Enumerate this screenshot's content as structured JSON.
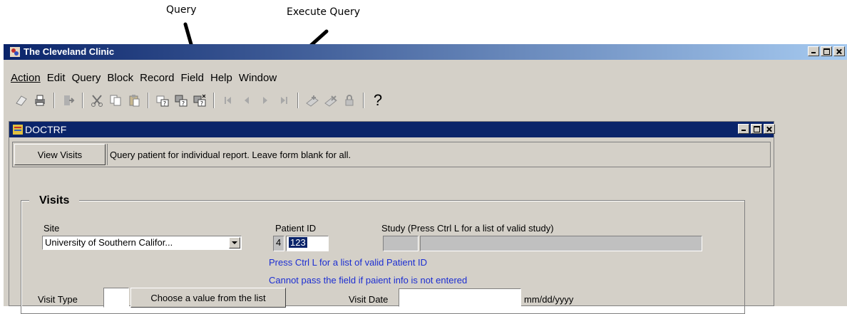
{
  "annotations": {
    "query_label": "Query",
    "execute_query_label": "Execute Query"
  },
  "app": {
    "title": "The Cleveland Clinic",
    "menu": [
      "Action",
      "Edit",
      "Query",
      "Block",
      "Record",
      "Field",
      "Help",
      "Window"
    ]
  },
  "toolbar": {
    "icons": [
      "save-icon",
      "print-icon",
      "exit-icon",
      "cut-icon",
      "copy-icon",
      "paste-icon",
      "enter-query-icon",
      "execute-query-icon",
      "cancel-query-icon",
      "first-record-icon",
      "previous-record-icon",
      "next-record-icon",
      "last-record-icon",
      "insert-record-icon",
      "delete-record-icon",
      "lock-record-icon",
      "help-icon"
    ],
    "help_glyph": "?"
  },
  "form": {
    "title": "DOCTRF",
    "view_visits_label": "View Visits",
    "instruction": "Query patient for individual report. Leave form blank for all.",
    "group_title": "Visits",
    "site_label": "Site",
    "site_value": "University of Southern Califor...",
    "patient_id_label": "Patient ID",
    "patient_prefix": "4",
    "patient_id_value": "123",
    "study_label": "Study (Press Ctrl L for a list of valid study)",
    "hint_patient": "Press Ctrl L for a list of valid Patient ID",
    "hint_required": "Cannot pass the field if paient info is not entered",
    "visit_type_label": "Visit Type",
    "choose_value_label": "Choose a value from the list",
    "visit_date_label": "Visit Date",
    "visit_date_format": "mm/dd/yyyy"
  },
  "colors": {
    "titlebar": "#0a246a",
    "window_bg": "#d4d0c8",
    "hint_text": "#1c2ed2"
  }
}
